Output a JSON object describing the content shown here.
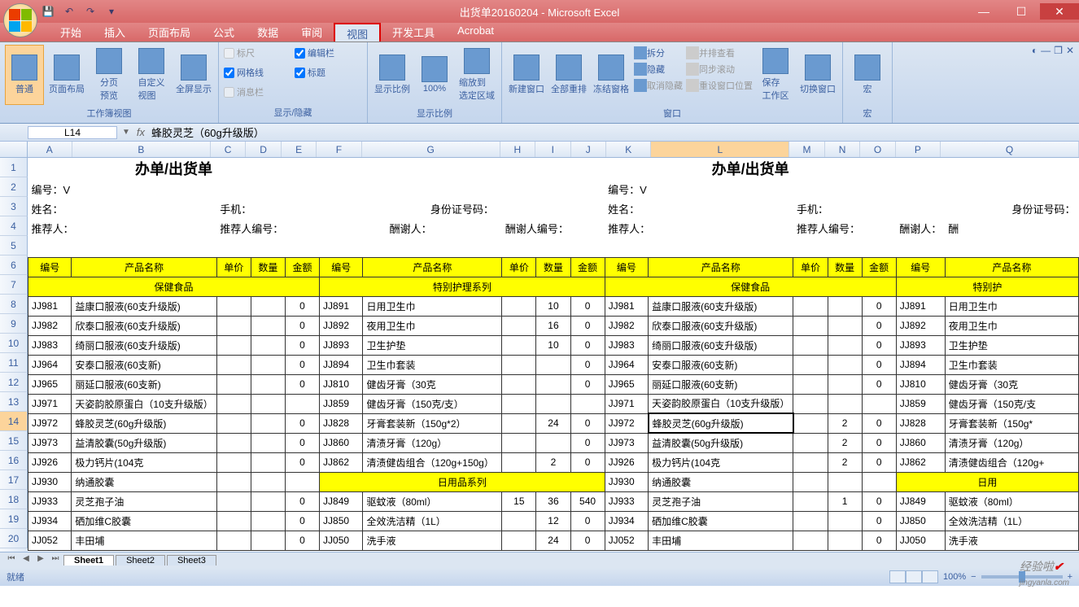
{
  "title": "出货单20160204 - Microsoft Excel",
  "tabs": [
    "开始",
    "插入",
    "页面布局",
    "公式",
    "数据",
    "审阅",
    "视图",
    "开发工具",
    "Acrobat"
  ],
  "active_tab": 6,
  "ribbon": {
    "g1": {
      "label": "工作簿视图",
      "btns": [
        "普通",
        "页面布局",
        "分页\n预览",
        "自定义\n视图",
        "全屏显示"
      ]
    },
    "g2": {
      "label": "显示/隐藏",
      "checks": [
        [
          "标尺",
          false,
          true
        ],
        [
          "网格线",
          true,
          false
        ],
        [
          "消息栏",
          false,
          true
        ],
        [
          "编辑栏",
          true,
          false
        ],
        [
          "标题",
          true,
          false
        ]
      ]
    },
    "g3": {
      "label": "显示比例",
      "btns": [
        "显示比例",
        "100%",
        "缩放到\n选定区域"
      ]
    },
    "g4": {
      "label": "窗口",
      "btns": [
        "新建窗口",
        "全部重排",
        "冻结窗格"
      ],
      "small": [
        "拆分",
        "隐藏",
        "取消隐藏",
        "并排查看",
        "同步滚动",
        "重设窗口位置"
      ],
      "btns2": [
        "保存\n工作区",
        "切换窗口"
      ]
    },
    "g5": {
      "label": "宏",
      "btn": "宏"
    }
  },
  "namebox": "L14",
  "formula": "蜂胶灵芝（60g升级版）",
  "cols": [
    {
      "l": "A",
      "w": 56
    },
    {
      "l": "B",
      "w": 172
    },
    {
      "l": "C",
      "w": 44
    },
    {
      "l": "D",
      "w": 44
    },
    {
      "l": "E",
      "w": 44
    },
    {
      "l": "F",
      "w": 56
    },
    {
      "l": "G",
      "w": 172
    },
    {
      "l": "H",
      "w": 44
    },
    {
      "l": "I",
      "w": 44
    },
    {
      "l": "J",
      "w": 44
    },
    {
      "l": "K",
      "w": 56
    },
    {
      "l": "L",
      "w": 172
    },
    {
      "l": "M",
      "w": 44
    },
    {
      "l": "N",
      "w": 44
    },
    {
      "l": "O",
      "w": 44
    },
    {
      "l": "P",
      "w": 56
    },
    {
      "l": "Q",
      "w": 172
    }
  ],
  "rows": [
    "1",
    "2",
    "3",
    "4",
    "5",
    "6",
    "7",
    "8",
    "9",
    "10",
    "11",
    "12",
    "13",
    "14",
    "15",
    "16",
    "17",
    "18",
    "19",
    "20"
  ],
  "sheet_title": "办单/出货单",
  "info": {
    "bianhao": "编号：V",
    "xingming": "姓名：",
    "shouji": "手机：",
    "shenfen": "身份证号码：",
    "tuijian": "推荐人：",
    "tuijianbh": "推荐人编号：",
    "chouxie": "酬谢人：",
    "chouxiebh": "酬谢人编号：",
    "chou": "酬"
  },
  "hdr": [
    "编号",
    "产品名称",
    "单价",
    "数量",
    "金额"
  ],
  "sections": {
    "baojian": "保健食品",
    "tebie": "特别护理系列",
    "riyong": "日用品系列",
    "tebie2": "特别护",
    "riyong2": "日用"
  },
  "left_block": [
    [
      "JJ981",
      "益康口服液(60支升级版)",
      "",
      "",
      "0"
    ],
    [
      "JJ982",
      "欣泰口服液(60支升级版)",
      "",
      "",
      "0"
    ],
    [
      "JJ983",
      "绮丽口服液(60支升级版)",
      "",
      "",
      "0"
    ],
    [
      "JJ964",
      "安泰口服液(60支新)",
      "",
      "",
      "0"
    ],
    [
      "JJ965",
      "丽延口服液(60支新)",
      "",
      "",
      "0"
    ],
    [
      "JJ971",
      "天姿韵胶原蛋白（10支升级版）",
      "",
      "",
      ""
    ],
    [
      "JJ972",
      "蜂胶灵芝(60g升级版)",
      "",
      "",
      "0"
    ],
    [
      "JJ973",
      "益清胶囊(50g升级版)",
      "",
      "",
      "0"
    ],
    [
      "JJ926",
      "极力钙片(104克",
      "",
      "",
      "0"
    ],
    [
      "JJ930",
      "纳通胶囊",
      "",
      "",
      ""
    ],
    [
      "JJ933",
      "灵芝孢子油",
      "",
      "",
      "0"
    ],
    [
      "JJ934",
      "硒加维C胶囊",
      "",
      "",
      "0"
    ],
    [
      "JJ052",
      "丰田埔",
      "",
      "",
      "0"
    ]
  ],
  "mid_block": [
    [
      "JJ891",
      "日用卫生巾",
      "",
      "10",
      "0"
    ],
    [
      "JJ892",
      "夜用卫生巾",
      "",
      "16",
      "0"
    ],
    [
      "JJ893",
      "卫生护垫",
      "",
      "10",
      "0"
    ],
    [
      "JJ894",
      "卫生巾套装",
      "",
      "",
      "0"
    ],
    [
      "JJ810",
      "健齿牙膏（30克",
      "",
      "",
      "0"
    ],
    [
      "JJ859",
      "健齿牙膏（150克/支）",
      "",
      "",
      ""
    ],
    [
      "JJ828",
      "牙膏套装新（150g*2）",
      "",
      "24",
      "0"
    ],
    [
      "JJ860",
      "清渍牙膏（120g）",
      "",
      "",
      "0"
    ],
    [
      "JJ862",
      "清渍健齿组合（120g+150g）",
      "",
      "2",
      "0"
    ]
  ],
  "riyong_block": [
    [
      "JJ849",
      "驱蚊液（80ml）",
      "15",
      "36",
      "540"
    ],
    [
      "JJ850",
      "全效洗洁精（1L）",
      "",
      "12",
      "0"
    ],
    [
      "JJ050",
      "洗手液",
      "",
      "24",
      "0"
    ]
  ],
  "right_block": [
    [
      "JJ981",
      "益康口服液(60支升级版)",
      "",
      "",
      "0"
    ],
    [
      "JJ982",
      "欣泰口服液(60支升级版)",
      "",
      "",
      "0"
    ],
    [
      "JJ983",
      "绮丽口服液(60支升级版)",
      "",
      "",
      "0"
    ],
    [
      "JJ964",
      "安泰口服液(60支新)",
      "",
      "",
      "0"
    ],
    [
      "JJ965",
      "丽延口服液(60支新)",
      "",
      "",
      "0"
    ],
    [
      "JJ971",
      "天姿韵胶原蛋白（10支升级版）",
      "",
      "",
      ""
    ],
    [
      "JJ972",
      "蜂胶灵芝(60g升级版)",
      "",
      "2",
      "0"
    ],
    [
      "JJ973",
      "益清胶囊(50g升级版)",
      "",
      "2",
      "0"
    ],
    [
      "JJ926",
      "极力钙片(104克",
      "",
      "2",
      "0"
    ],
    [
      "JJ930",
      "纳通胶囊",
      "",
      "",
      ""
    ],
    [
      "JJ933",
      "灵芝孢子油",
      "",
      "1",
      "0"
    ],
    [
      "JJ934",
      "硒加维C胶囊",
      "",
      "",
      "0"
    ],
    [
      "JJ052",
      "丰田埔",
      "",
      "",
      "0"
    ]
  ],
  "far_block": [
    [
      "JJ891",
      "日用卫生巾"
    ],
    [
      "JJ892",
      "夜用卫生巾"
    ],
    [
      "JJ893",
      "卫生护垫"
    ],
    [
      "JJ894",
      "卫生巾套装"
    ],
    [
      "JJ810",
      "健齿牙膏（30克"
    ],
    [
      "JJ859",
      "健齿牙膏（150克/支"
    ],
    [
      "JJ828",
      "牙膏套装新（150g*"
    ],
    [
      "JJ860",
      "清渍牙膏（120g）"
    ],
    [
      "JJ862",
      "清渍健齿组合（120g+"
    ]
  ],
  "far_riyong": [
    [
      "JJ849",
      "驱蚊液（80ml）"
    ],
    [
      "JJ850",
      "全效洗洁精（1L）"
    ],
    [
      "JJ050",
      "洗手液"
    ]
  ],
  "sheets": [
    "Sheet1",
    "Sheet2",
    "Sheet3"
  ],
  "status": "就绪",
  "zoom": "100%",
  "watermark": {
    "text": "经验啦",
    "suffix": "jingyanla",
    "dom": ".com"
  }
}
